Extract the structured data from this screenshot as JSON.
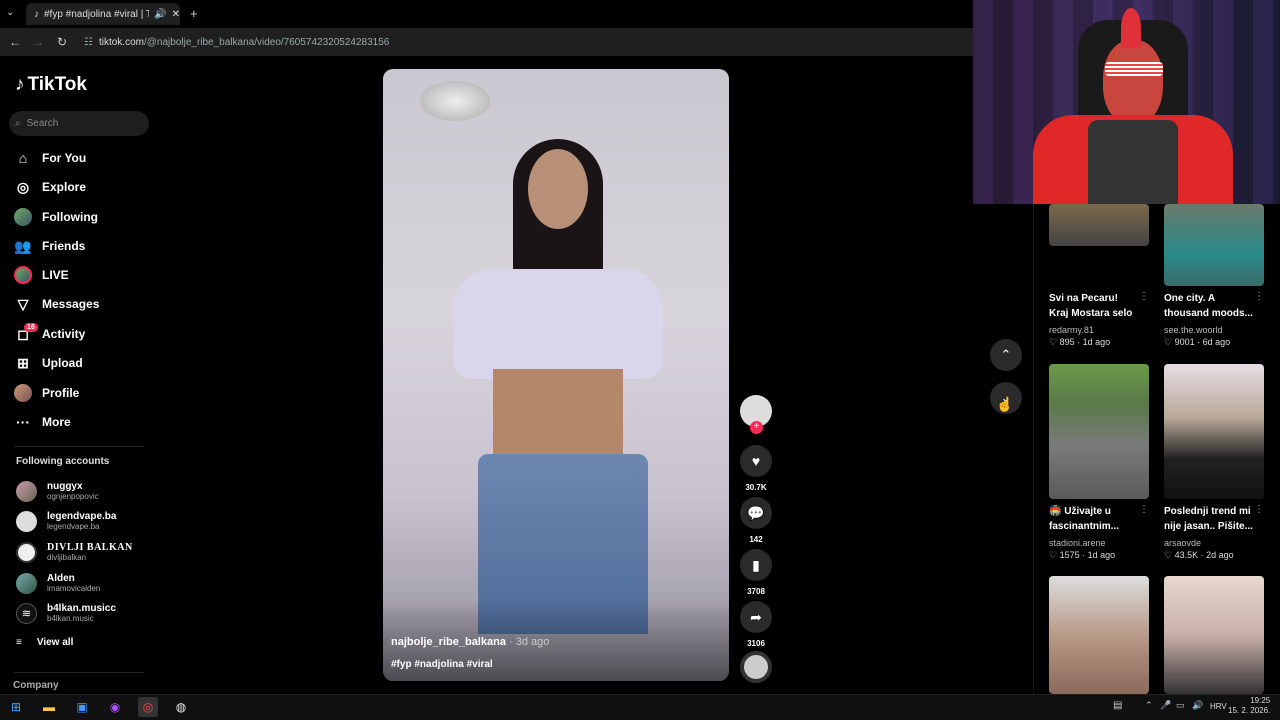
{
  "browser": {
    "tab_title": "#fyp #nadjolina #viral | Tik",
    "url_domain": "tiktok.com",
    "url_path": "/@najbolje_ribe_balkana/video/7605742320524283156"
  },
  "sidebar": {
    "logo": "TikTok",
    "search_placeholder": "Search",
    "items": [
      {
        "label": "For You",
        "icon": "home-icon"
      },
      {
        "label": "Explore",
        "icon": "compass-icon"
      },
      {
        "label": "Following",
        "icon": "following-avatar-icon"
      },
      {
        "label": "Friends",
        "icon": "friends-icon"
      },
      {
        "label": "LIVE",
        "icon": "live-icon"
      },
      {
        "label": "Messages",
        "icon": "messages-icon"
      },
      {
        "label": "Activity",
        "icon": "activity-icon"
      },
      {
        "label": "Upload",
        "icon": "upload-icon"
      },
      {
        "label": "Profile",
        "icon": "profile-avatar-icon"
      },
      {
        "label": "More",
        "icon": "more-icon"
      }
    ],
    "activity_badge": "16",
    "following_title": "Following accounts",
    "accounts": [
      {
        "name": "nuggyx",
        "handle": "ognjenpopovic"
      },
      {
        "name": "legendvape.ba",
        "handle": "legendvape.ba"
      },
      {
        "name": "DIVLJI BALKAN",
        "handle": "divljibalkan"
      },
      {
        "name": "Alden",
        "handle": "imamovicalden"
      },
      {
        "name": "b4lkan.musicc",
        "handle": "b4lkan.music"
      }
    ],
    "view_all": "View all",
    "company": "Company"
  },
  "video": {
    "username": "najbolje_ribe_balkana",
    "date": " · 3d ago",
    "tags": "#fyp #nadjolina #viral"
  },
  "actions": {
    "likes": "30.7K",
    "comments": "142",
    "saves": "3708",
    "shares": "3106"
  },
  "grid": [
    {
      "title": "Svi na Pecaru! Kraj Mostara selo mal...",
      "user": "redarmy.81",
      "likes": "895",
      "age": "1d ago"
    },
    {
      "title": "One city. A thousand moods...",
      "user": "see.the.woorld",
      "likes": "9001",
      "age": "6d ago"
    },
    {
      "title": "🏟️ Uživajte u fascinantnim...",
      "user": "stadioni.arene",
      "likes": "1575",
      "age": "1d ago"
    },
    {
      "title": "Poslednji trend mi nije jasan.. Pišite...",
      "user": "arsaovde",
      "likes": "43.5K",
      "age": "2d ago"
    }
  ],
  "taskbar": {
    "time": "19:25",
    "date": "15. 2. 2026.",
    "lang": "HRV"
  }
}
